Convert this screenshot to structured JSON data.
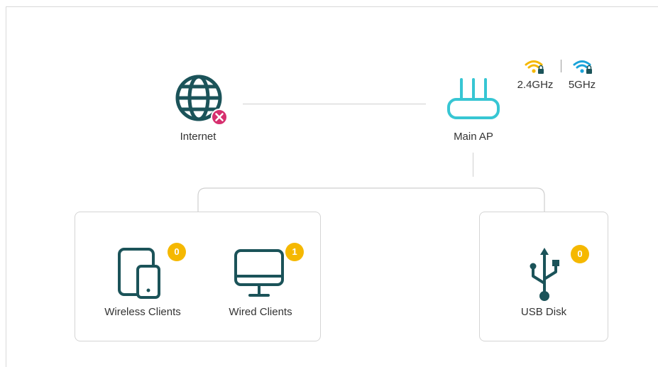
{
  "topology": {
    "internet": {
      "label": "Internet",
      "status": "disconnected"
    },
    "main_ap": {
      "label": "Main AP"
    },
    "wifi_bands": [
      {
        "label": "2.4GHz",
        "color": "#f5b800",
        "icon": "wifi-lock-icon"
      },
      {
        "label": "5GHz",
        "color": "#1aa3d9",
        "icon": "wifi-lock-icon"
      }
    ]
  },
  "clients_panel": {
    "wireless": {
      "label": "Wireless Clients",
      "count": "0",
      "icon": "tablet-phone-icon"
    },
    "wired": {
      "label": "Wired Clients",
      "count": "1",
      "icon": "monitor-icon"
    }
  },
  "usb_panel": {
    "usb_disk": {
      "label": "USB Disk",
      "count": "0",
      "icon": "usb-icon"
    }
  },
  "colors": {
    "icon_dark": "#1b5359",
    "ap_accent": "#37c6d3",
    "badge": "#f5b800",
    "error": "#d62f6e",
    "line": "#cfcfcf"
  }
}
